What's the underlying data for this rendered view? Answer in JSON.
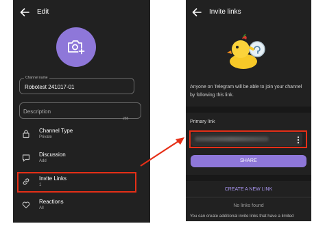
{
  "left_screen": {
    "title": "Edit",
    "channel_name_label": "Channel name",
    "channel_name_value": "Robotest 241017-01",
    "description_placeholder": "Description",
    "description_counter": "255",
    "rows": [
      {
        "title": "Channel Type",
        "subtitle": "Private",
        "icon": "lock-icon"
      },
      {
        "title": "Discussion",
        "subtitle": "Add",
        "icon": "chat-bubble-icon"
      },
      {
        "title": "Invite Links",
        "subtitle": "1",
        "icon": "link-icon"
      },
      {
        "title": "Reactions",
        "subtitle": "All",
        "icon": "heart-icon"
      }
    ]
  },
  "right_screen": {
    "title": "Invite links",
    "description": "Anyone on Telegram will be able to join your channel by following this link.",
    "primary_link_label": "Primary link",
    "share_label": "SHARE",
    "create_link_label": "CREATE A NEW LINK",
    "no_links_label": "No links found",
    "footer_text": "You can create additional invite links that have a limited"
  },
  "colors": {
    "background": "#212121",
    "accent": "#8e77d9",
    "highlight": "#e62f17"
  }
}
